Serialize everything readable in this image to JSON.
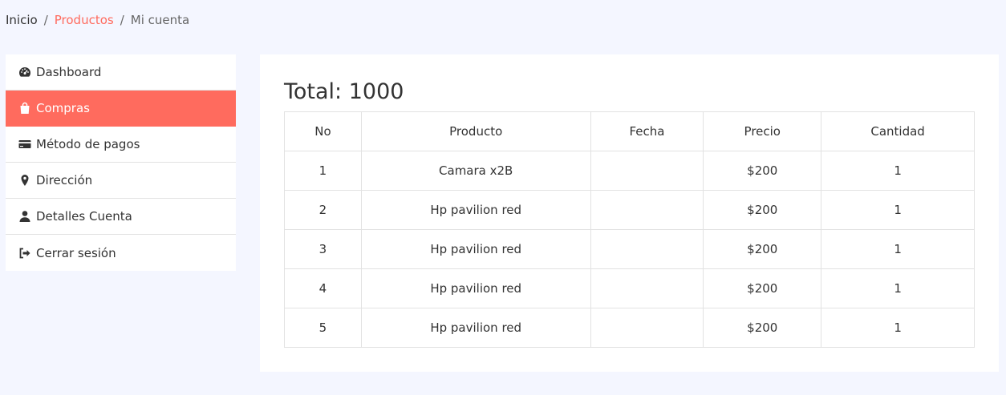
{
  "breadcrumb": {
    "home": "Inicio",
    "products": "Productos",
    "current": "Mi cuenta",
    "separator": "/"
  },
  "sidebar": {
    "items": [
      {
        "label": "Dashboard",
        "icon": "dashboard-icon"
      },
      {
        "label": "Compras",
        "icon": "shopping-bag-icon",
        "active": true
      },
      {
        "label": "Método de pagos",
        "icon": "credit-card-icon"
      },
      {
        "label": "Dirección",
        "icon": "map-marker-icon"
      },
      {
        "label": "Detalles Cuenta",
        "icon": "user-icon"
      },
      {
        "label": "Cerrar sesión",
        "icon": "sign-out-icon"
      }
    ]
  },
  "main": {
    "total": "Total: 1000",
    "table": {
      "headers": [
        "No",
        "Producto",
        "Fecha",
        "Precio",
        "Cantidad"
      ],
      "rows": [
        [
          "1",
          "Camara x2B",
          "",
          "$200",
          "1"
        ],
        [
          "2",
          "Hp pavilion red",
          "",
          "$200",
          "1"
        ],
        [
          "3",
          "Hp pavilion red",
          "",
          "$200",
          "1"
        ],
        [
          "4",
          "Hp pavilion red",
          "",
          "$200",
          "1"
        ],
        [
          "5",
          "Hp pavilion red",
          "",
          "$200",
          "1"
        ]
      ]
    }
  },
  "colors": {
    "accent": "#ff6b5e",
    "background": "#f4f6ff"
  }
}
